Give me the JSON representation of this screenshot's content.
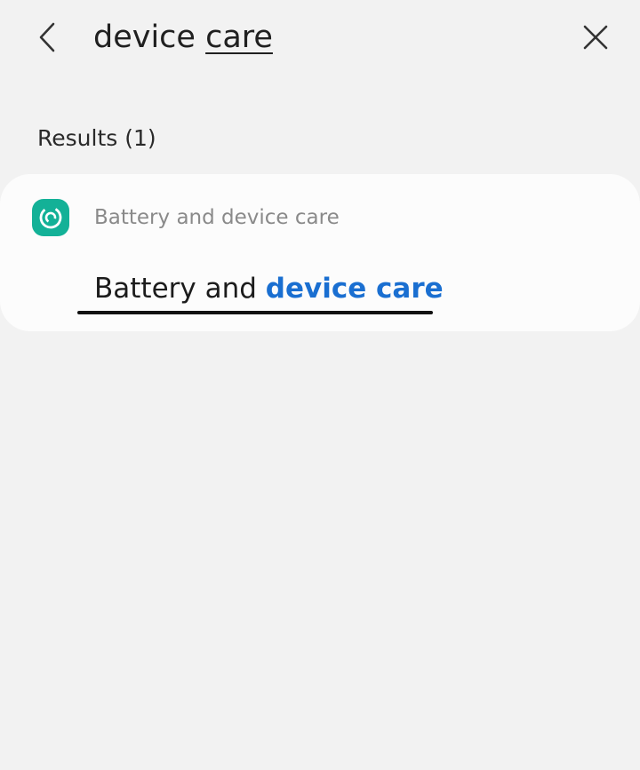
{
  "search": {
    "query_prefix": "device ",
    "query_composing": "care"
  },
  "results": {
    "header": "Results (1)",
    "items": [
      {
        "category": "Battery and device care",
        "title_prefix": "Battery and ",
        "title_match": "device care",
        "icon": "device-care-icon"
      }
    ]
  },
  "colors": {
    "background": "#f2f2f2",
    "card": "#fcfcfc",
    "icon_bg": "#13b197",
    "highlight": "#1a6fd1"
  },
  "icons": {
    "back": "back-arrow-icon",
    "clear": "close-icon"
  }
}
